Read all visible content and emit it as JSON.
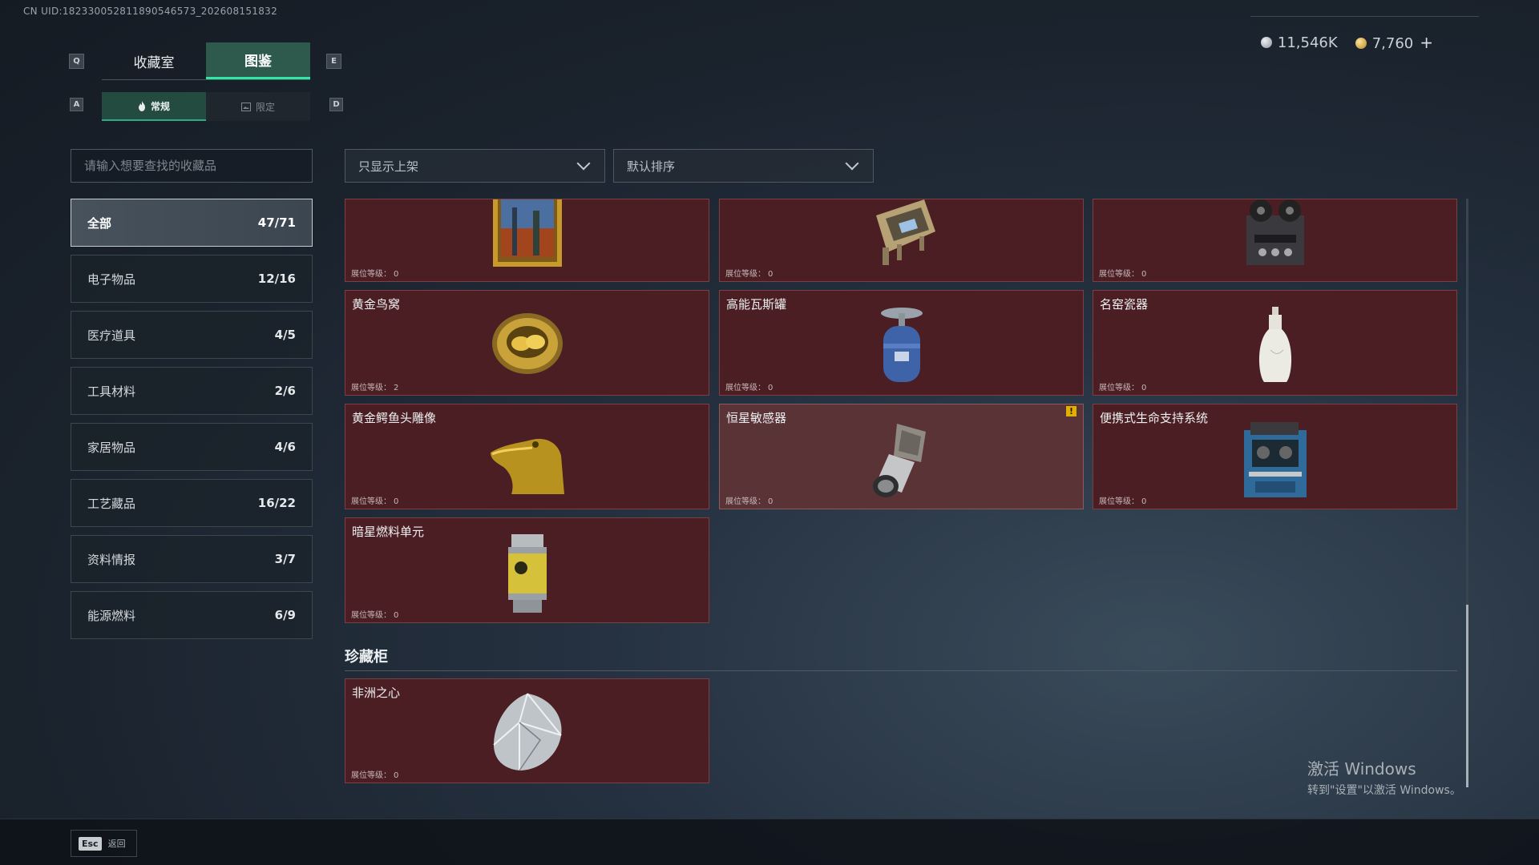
{
  "uid": "CN UID:18233005281189054657​3_202608151832",
  "keys": {
    "prev_tab": "Q",
    "next_tab": "E",
    "prev_sub": "A",
    "next_sub": "D"
  },
  "tabs": [
    {
      "label": "收藏室"
    },
    {
      "label": "图鉴"
    }
  ],
  "sub_tabs": [
    {
      "label": "常规"
    },
    {
      "label": "限定"
    }
  ],
  "currency": {
    "silver": "11,546K",
    "gold": "7,760",
    "add": "+"
  },
  "search": {
    "placeholder": "请输入想要查找的收藏品"
  },
  "filters": {
    "show": "只显示上架",
    "sort": "默认排序"
  },
  "categories": [
    {
      "name": "全部",
      "count": "47/71"
    },
    {
      "name": "电子物品",
      "count": "12/16"
    },
    {
      "name": "医疗道具",
      "count": "4/5"
    },
    {
      "name": "工具材料",
      "count": "2/6"
    },
    {
      "name": "家居物品",
      "count": "4/6"
    },
    {
      "name": "工艺藏品",
      "count": "16/22"
    },
    {
      "name": "资料情报",
      "count": "3/7"
    },
    {
      "name": "能源燃料",
      "count": "6/9"
    }
  ],
  "level_label": "展位等级：",
  "items": [
    {
      "name": "",
      "level": "0"
    },
    {
      "name": "",
      "level": "0"
    },
    {
      "name": "",
      "level": "0"
    },
    {
      "name": "黄金鸟窝",
      "level": "2"
    },
    {
      "name": "高能瓦斯罐",
      "level": "0"
    },
    {
      "name": "名窑瓷器",
      "level": "0"
    },
    {
      "name": "黄金鳄鱼头雕像",
      "level": "0"
    },
    {
      "name": "恒星敏感器",
      "level": "0",
      "warning": "!"
    },
    {
      "name": "便携式生命支持系统",
      "level": "0"
    },
    {
      "name": "暗星燃料单元",
      "level": "0"
    }
  ],
  "cabinet": {
    "title": "珍藏柜",
    "items": [
      {
        "name": "非洲之心",
        "level": "0"
      }
    ]
  },
  "footer": {
    "esc": "Esc",
    "back": "返回"
  },
  "watermark": {
    "line1": "激活 Windows",
    "line2": "转到\"设置\"以激活 Windows。"
  }
}
